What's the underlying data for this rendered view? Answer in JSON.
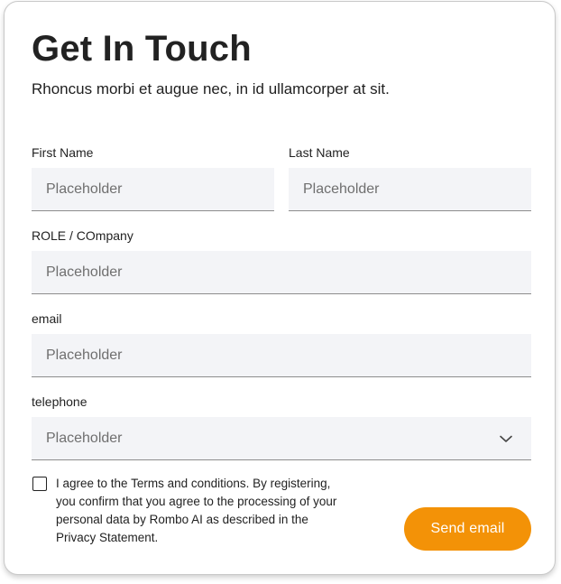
{
  "form": {
    "title": "Get In Touch",
    "subtitle": "Rhoncus morbi et augue nec, in id ullamcorper at sit.",
    "fields": {
      "first_name": {
        "label": "First Name",
        "placeholder": "Placeholder"
      },
      "last_name": {
        "label": "Last Name",
        "placeholder": "Placeholder"
      },
      "role_company": {
        "label": "ROLE / COmpany",
        "placeholder": "Placeholder"
      },
      "email": {
        "label": "email",
        "placeholder": "Placeholder"
      },
      "telephone": {
        "label": "telephone",
        "placeholder": "Placeholder",
        "icon": "chevron-down-icon"
      }
    },
    "consent": {
      "checked": false,
      "text": "I agree to the Terms and conditions. By registering, you confirm that you agree to the processing of your personal data by Rombo AI as described in the Privacy Statement."
    },
    "submit_label": "Send email"
  },
  "colors": {
    "accent": "#f39207",
    "field_background": "#f3f4f7",
    "field_underline": "#8d8d8d",
    "placeholder": "#6f6f6f",
    "text": "#222222",
    "card_border": "#c8c8c8"
  }
}
